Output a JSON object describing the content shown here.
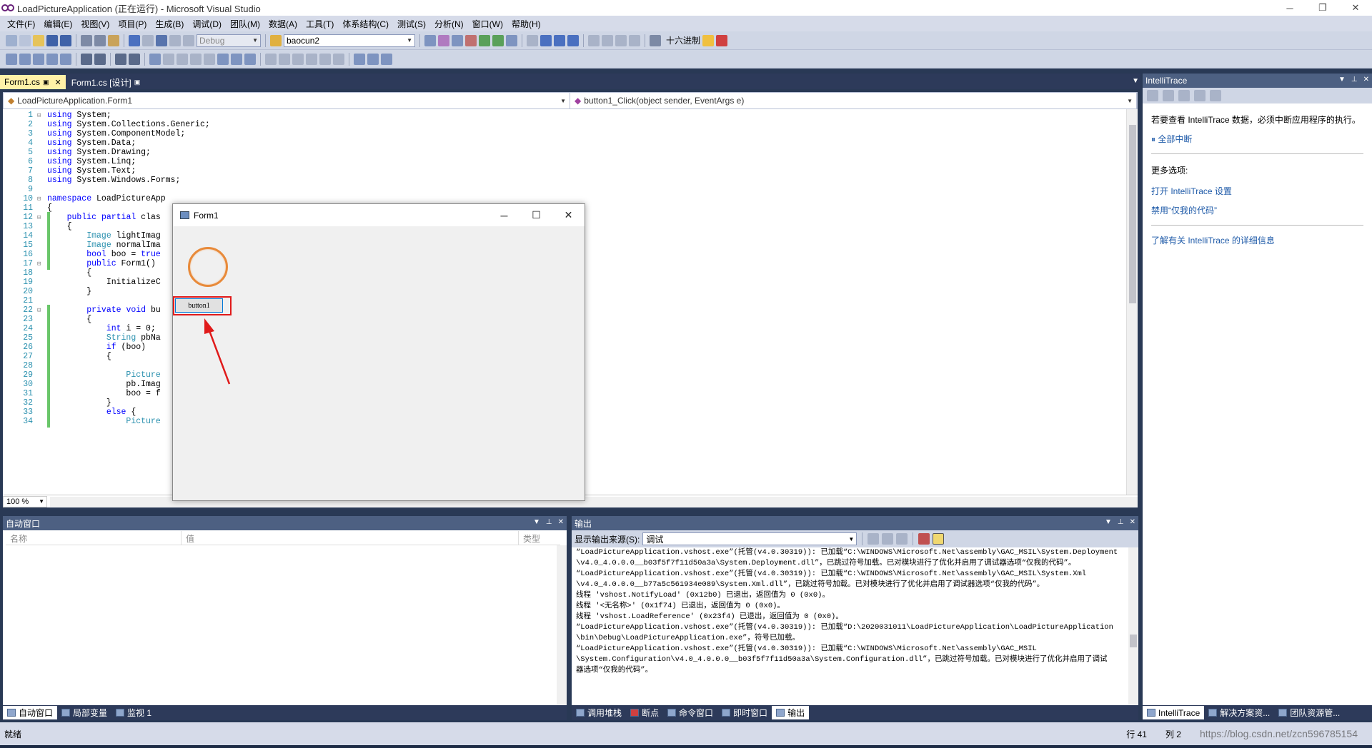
{
  "window": {
    "title": "LoadPictureApplication (正在运行) - Microsoft Visual Studio",
    "minimize": "─",
    "restore": "❐",
    "close": "✕"
  },
  "menu": [
    "文件(F)",
    "编辑(E)",
    "视图(V)",
    "项目(P)",
    "生成(B)",
    "调试(D)",
    "团队(M)",
    "数据(A)",
    "工具(T)",
    "体系结构(C)",
    "测试(S)",
    "分析(N)",
    "窗口(W)",
    "帮助(H)"
  ],
  "toolbar": {
    "config": "Debug",
    "search_combo": "baocun2",
    "hex_label": "十六进制"
  },
  "tabs": [
    {
      "label": "Form1.cs",
      "lock": "🔒",
      "close": "✕"
    },
    {
      "label": "Form1.cs [设计]",
      "lock": "🔒"
    }
  ],
  "nav": {
    "class_combo": "LoadPictureApplication.Form1",
    "member_combo": "button1_Click(object sender, EventArgs e)"
  },
  "code_lines": [
    {
      "n": "1",
      "t": "using System;"
    },
    {
      "n": "2",
      "t": "using System.Collections.Generic;"
    },
    {
      "n": "3",
      "t": "using System.ComponentModel;"
    },
    {
      "n": "4",
      "t": "using System.Data;"
    },
    {
      "n": "5",
      "t": "using System.Drawing;"
    },
    {
      "n": "6",
      "t": "using System.Linq;"
    },
    {
      "n": "7",
      "t": "using System.Text;"
    },
    {
      "n": "8",
      "t": "using System.Windows.Forms;"
    },
    {
      "n": "9",
      "t": ""
    },
    {
      "n": "10",
      "t": "namespace LoadPictureApp"
    },
    {
      "n": "11",
      "t": "{"
    },
    {
      "n": "12",
      "t": "    public partial clas"
    },
    {
      "n": "13",
      "t": "    {"
    },
    {
      "n": "14",
      "t": "        Image lightImag"
    },
    {
      "n": "15",
      "t": "        Image normalIma"
    },
    {
      "n": "16",
      "t": "        bool boo = true"
    },
    {
      "n": "17",
      "t": "        public Form1()"
    },
    {
      "n": "18",
      "t": "        {"
    },
    {
      "n": "19",
      "t": "            InitializeC"
    },
    {
      "n": "20",
      "t": "        }"
    },
    {
      "n": "21",
      "t": ""
    },
    {
      "n": "22",
      "t": "        private void bu"
    },
    {
      "n": "23",
      "t": "        {"
    },
    {
      "n": "24",
      "t": "            int i = 0;"
    },
    {
      "n": "25",
      "t": "            String pbNa"
    },
    {
      "n": "26",
      "t": "            if (boo)"
    },
    {
      "n": "27",
      "t": "            {"
    },
    {
      "n": "28",
      "t": ""
    },
    {
      "n": "29",
      "t": "                Picture"
    },
    {
      "n": "30",
      "t": "                pb.Imag"
    },
    {
      "n": "31",
      "t": "                boo = f"
    },
    {
      "n": "32",
      "t": "            }"
    },
    {
      "n": "33",
      "t": "            else {"
    },
    {
      "n": "34",
      "t": "                Picture"
    }
  ],
  "zoom": "100 %",
  "form1": {
    "title": "Form1",
    "button_label": "button1"
  },
  "intellitrace": {
    "title": "IntelliTrace",
    "message": "若要查看 IntelliTrace 数据，必须中断应用程序的执行。",
    "break_all": "全部中断",
    "more_options": "更多选项:",
    "open_settings": "打开 IntelliTrace 设置",
    "disable_just_my_code": "禁用“仅我的代码”",
    "learn_more": "了解有关 IntelliTrace 的详细信息"
  },
  "autos": {
    "title": "自动窗口",
    "col_name": "名称",
    "col_value": "值",
    "col_type": "类型"
  },
  "output": {
    "title": "输出",
    "source_label": "显示输出来源(S):",
    "source_value": "调试",
    "lines": [
      "“LoadPictureApplication.vshost.exe”(托管(v4.0.30319)): 已加载“C:\\WINDOWS\\Microsoft.Net\\assembly\\GAC_MSIL\\System.Deployment",
      "\\v4.0_4.0.0.0__b03f5f7f11d50a3a\\System.Deployment.dll”，已跳过符号加载。已对模块进行了优化并启用了调试器选项“仅我的代码”。",
      "“LoadPictureApplication.vshost.exe”(托管(v4.0.30319)): 已加载“C:\\WINDOWS\\Microsoft.Net\\assembly\\GAC_MSIL\\System.Xml",
      "\\v4.0_4.0.0.0__b77a5c561934e089\\System.Xml.dll”，已跳过符号加载。已对模块进行了优化并启用了调试器选项“仅我的代码”。",
      "线程 'vshost.NotifyLoad' (0x12b0) 已退出，返回值为 0 (0x0)。",
      "线程 '<无名称>' (0x1f74) 已退出，返回值为 0 (0x0)。",
      "线程 'vshost.LoadReference' (0x23f4) 已退出，返回值为 0 (0x0)。",
      "“LoadPictureApplication.vshost.exe”(托管(v4.0.30319)): 已加载“D:\\2020031011\\LoadPictureApplication\\LoadPictureApplication",
      "\\bin\\Debug\\LoadPictureApplication.exe”，符号已加载。",
      "“LoadPictureApplication.vshost.exe”(托管(v4.0.30319)): 已加载“C:\\WINDOWS\\Microsoft.Net\\assembly\\GAC_MSIL",
      "\\System.Configuration\\v4.0_4.0.0.0__b03f5f7f11d50a3a\\System.Configuration.dll”，已跳过符号加载。已对模块进行了优化并启用了调试",
      "器选项“仅我的代码”。"
    ]
  },
  "bottom_tabs_left": [
    "自动窗口",
    "局部变量",
    "监视 1"
  ],
  "bottom_tabs_right": [
    "调用堆栈",
    "断点",
    "命令窗口",
    "即时窗口",
    "输出"
  ],
  "right_tabs": [
    "IntelliTrace",
    "解决方案资...",
    "团队资源管..."
  ],
  "status": {
    "left": "就绪",
    "row": "行 41",
    "col": "列 2",
    "watermark": "https://blog.csdn.net/zcn596785154"
  }
}
